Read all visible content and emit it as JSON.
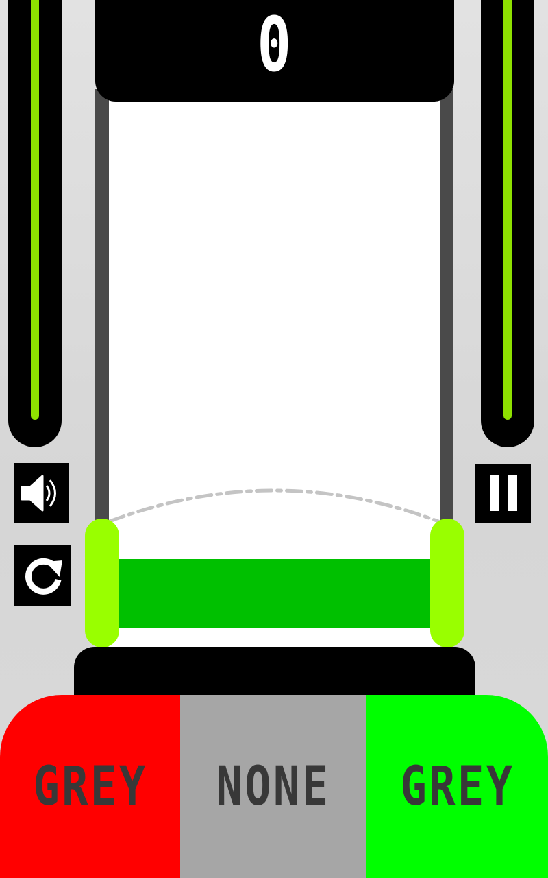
{
  "score": "0",
  "timers": {
    "left_level": 1.0,
    "right_level": 1.0,
    "fill_color": "#8ee000"
  },
  "tube": {
    "liquid_color": "#00c000",
    "clamp_color": "#99ff00"
  },
  "controls": {
    "sound_icon": "speaker-icon",
    "restart_icon": "restart-icon",
    "pause_icon": "pause-icon"
  },
  "choices": [
    {
      "label": "GREY",
      "color": "#ff0000"
    },
    {
      "label": "NONE",
      "color": "#a6a6a6"
    },
    {
      "label": "GREY",
      "color": "#00ff00"
    }
  ]
}
